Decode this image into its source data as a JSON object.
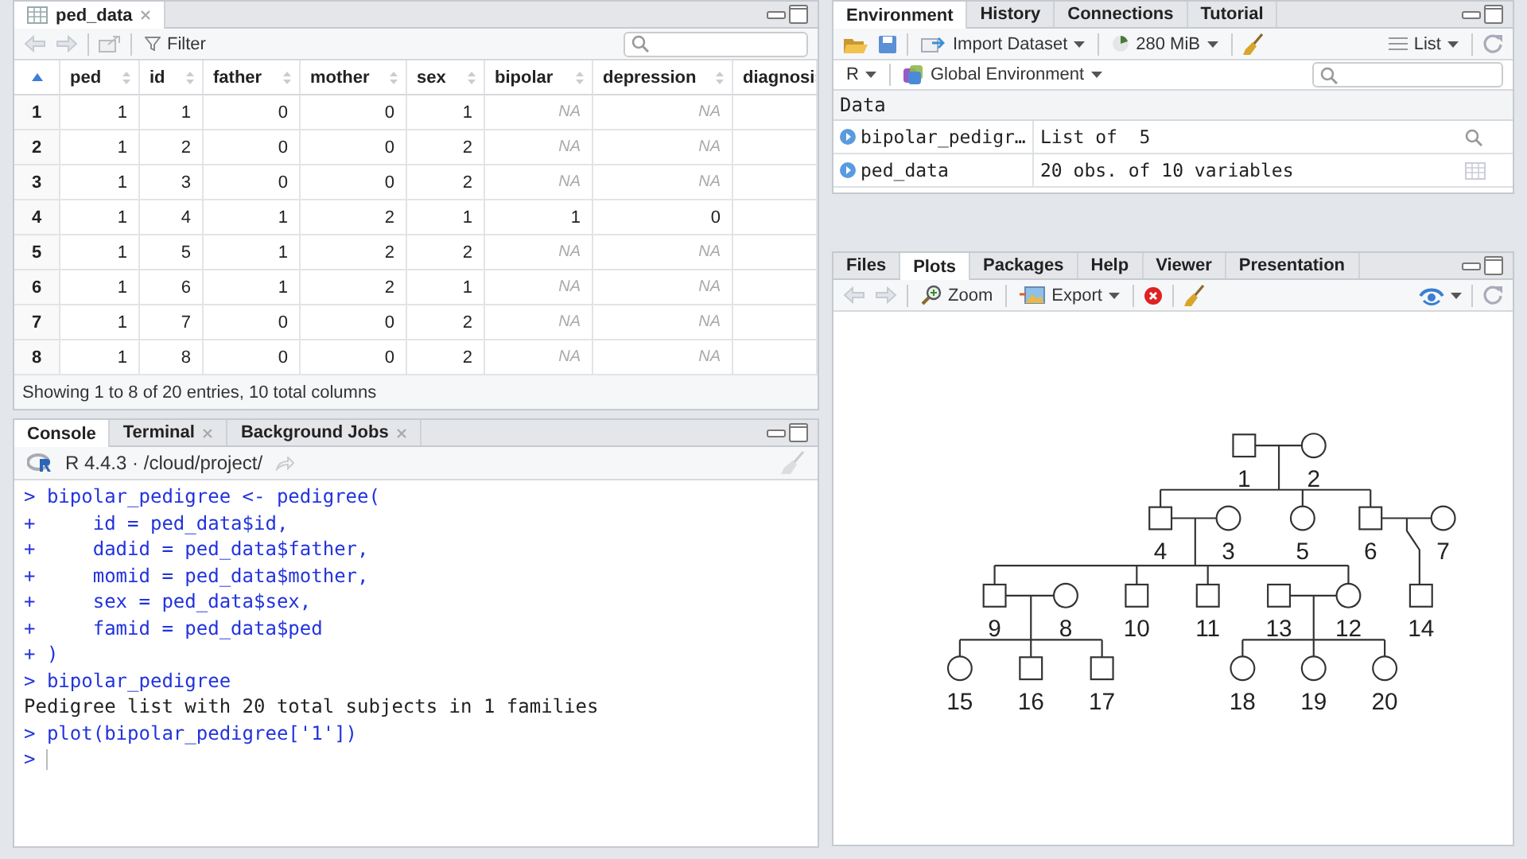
{
  "source_pane": {
    "tabs": [
      {
        "label": "ped_data",
        "selected": true,
        "closable": true
      }
    ],
    "filter": "Filter",
    "table": {
      "columns": [
        "ped",
        "id",
        "father",
        "mother",
        "sex",
        "bipolar",
        "depression",
        "diagnosi"
      ],
      "rows": [
        {
          "index": "1",
          "cells": [
            "1",
            "1",
            "0",
            "0",
            "1",
            "NA",
            "NA"
          ],
          "missing": [
            false,
            false,
            false,
            false,
            false,
            true,
            true
          ]
        },
        {
          "index": "2",
          "cells": [
            "1",
            "2",
            "0",
            "0",
            "2",
            "NA",
            "NA"
          ],
          "missing": [
            false,
            false,
            false,
            false,
            false,
            true,
            true
          ]
        },
        {
          "index": "3",
          "cells": [
            "1",
            "3",
            "0",
            "0",
            "2",
            "NA",
            "NA"
          ],
          "missing": [
            false,
            false,
            false,
            false,
            false,
            true,
            true
          ]
        },
        {
          "index": "4",
          "cells": [
            "1",
            "4",
            "1",
            "2",
            "1",
            "1",
            "0"
          ],
          "missing": [
            false,
            false,
            false,
            false,
            false,
            false,
            false
          ]
        },
        {
          "index": "5",
          "cells": [
            "1",
            "5",
            "1",
            "2",
            "2",
            "NA",
            "NA"
          ],
          "missing": [
            false,
            false,
            false,
            false,
            false,
            true,
            true
          ]
        },
        {
          "index": "6",
          "cells": [
            "1",
            "6",
            "1",
            "2",
            "1",
            "NA",
            "NA"
          ],
          "missing": [
            false,
            false,
            false,
            false,
            false,
            true,
            true
          ]
        },
        {
          "index": "7",
          "cells": [
            "1",
            "7",
            "0",
            "0",
            "2",
            "NA",
            "NA"
          ],
          "missing": [
            false,
            false,
            false,
            false,
            false,
            true,
            true
          ]
        },
        {
          "index": "8",
          "cells": [
            "1",
            "8",
            "0",
            "0",
            "2",
            "NA",
            "NA"
          ],
          "missing": [
            false,
            false,
            false,
            false,
            false,
            true,
            true
          ]
        }
      ],
      "footer": "Showing 1 to 8 of 20 entries, 10 total columns"
    }
  },
  "env_pane": {
    "tabs": [
      {
        "label": "Environment",
        "selected": true
      },
      {
        "label": "History",
        "selected": false
      },
      {
        "label": "Connections",
        "selected": false
      },
      {
        "label": "Tutorial",
        "selected": false
      }
    ],
    "import": "Import Dataset",
    "memory": "280 MiB",
    "view": "List",
    "language": "R",
    "scope": "Global Environment",
    "section": "Data",
    "objects": [
      {
        "name": "bipolar_pedigr…",
        "value": "List of  5",
        "kind": "list"
      },
      {
        "name": "ped_data",
        "value": "20 obs. of 10 variables",
        "kind": "table"
      }
    ]
  },
  "console_pane": {
    "tabs": [
      {
        "label": "Console",
        "selected": true,
        "closable": false
      },
      {
        "label": "Terminal",
        "selected": false,
        "closable": true
      },
      {
        "label": "Background Jobs",
        "selected": false,
        "closable": true
      }
    ],
    "session": "R 4.4.3 · /cloud/project/",
    "lines": [
      {
        "text": "> bipolar_pedigree <- pedigree(",
        "kind": "input"
      },
      {
        "text": "+     id = ped_data$id,",
        "kind": "input"
      },
      {
        "text": "+     dadid = ped_data$father,",
        "kind": "input"
      },
      {
        "text": "+     momid = ped_data$mother,",
        "kind": "input"
      },
      {
        "text": "+     sex = ped_data$sex,",
        "kind": "input"
      },
      {
        "text": "+     famid = ped_data$ped",
        "kind": "input"
      },
      {
        "text": "+ )",
        "kind": "input"
      },
      {
        "text": "> bipolar_pedigree",
        "kind": "input"
      },
      {
        "text": "Pedigree list with 20 total subjects in 1 families",
        "kind": "output"
      },
      {
        "text": "> plot(bipolar_pedigree['1'])",
        "kind": "input"
      },
      {
        "text": ">",
        "kind": "prompt"
      }
    ]
  },
  "plots_pane": {
    "tabs": [
      {
        "label": "Files",
        "selected": false
      },
      {
        "label": "Plots",
        "selected": true
      },
      {
        "label": "Packages",
        "selected": false
      },
      {
        "label": "Help",
        "selected": false
      },
      {
        "label": "Viewer",
        "selected": false
      },
      {
        "label": "Presentation",
        "selected": false
      }
    ],
    "zoom": "Zoom",
    "export": "Export",
    "pedigree": {
      "nodes": [
        {
          "label": "1",
          "kind": "square"
        },
        {
          "label": "2",
          "kind": "circle"
        },
        {
          "label": "4",
          "kind": "square"
        },
        {
          "label": "3",
          "kind": "circle"
        },
        {
          "label": "5",
          "kind": "circle"
        },
        {
          "label": "6",
          "kind": "square"
        },
        {
          "label": "7",
          "kind": "circle"
        },
        {
          "label": "9",
          "kind": "square"
        },
        {
          "label": "8",
          "kind": "circle"
        },
        {
          "label": "10",
          "kind": "square"
        },
        {
          "label": "11",
          "kind": "square"
        },
        {
          "label": "13",
          "kind": "square"
        },
        {
          "label": "12",
          "kind": "circle"
        },
        {
          "label": "14",
          "kind": "square"
        },
        {
          "label": "15",
          "kind": "circle"
        },
        {
          "label": "16",
          "kind": "square"
        },
        {
          "label": "17",
          "kind": "square"
        },
        {
          "label": "18",
          "kind": "circle"
        },
        {
          "label": "19",
          "kind": "circle"
        },
        {
          "label": "20",
          "kind": "circle"
        }
      ]
    }
  }
}
